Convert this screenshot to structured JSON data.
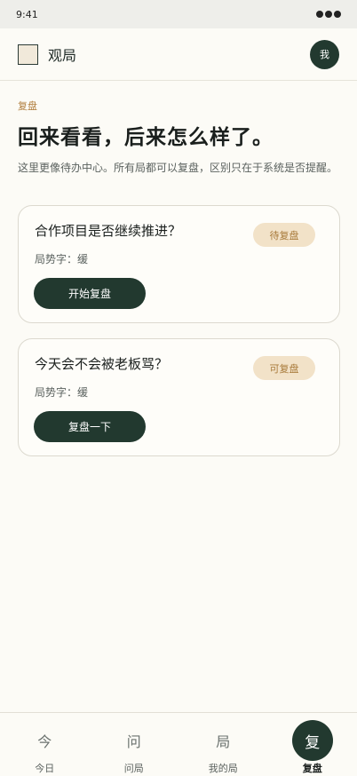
{
  "status": {
    "time": "9:41"
  },
  "header": {
    "app_name": "观局",
    "avatar_text": "我"
  },
  "page": {
    "eyebrow": "复盘",
    "title": "回来看看，后来怎么样了。",
    "description": "这里更像待办中心。所有局都可以复盘，区别只在于系统是否提醒。"
  },
  "cards": [
    {
      "title": "合作项目是否继续推进？",
      "badge": "待复盘",
      "meta": "局势字：缓",
      "button": "开始复盘"
    },
    {
      "title": "今天会不会被老板骂？",
      "badge": "可复盘",
      "meta": "局势字：缓",
      "button": "复盘一下"
    }
  ],
  "tabs": [
    {
      "icon": "今",
      "label": "今日"
    },
    {
      "icon": "问",
      "label": "问局"
    },
    {
      "icon": "局",
      "label": "我的局"
    },
    {
      "icon": "复",
      "label": "复盘",
      "active": true
    }
  ]
}
